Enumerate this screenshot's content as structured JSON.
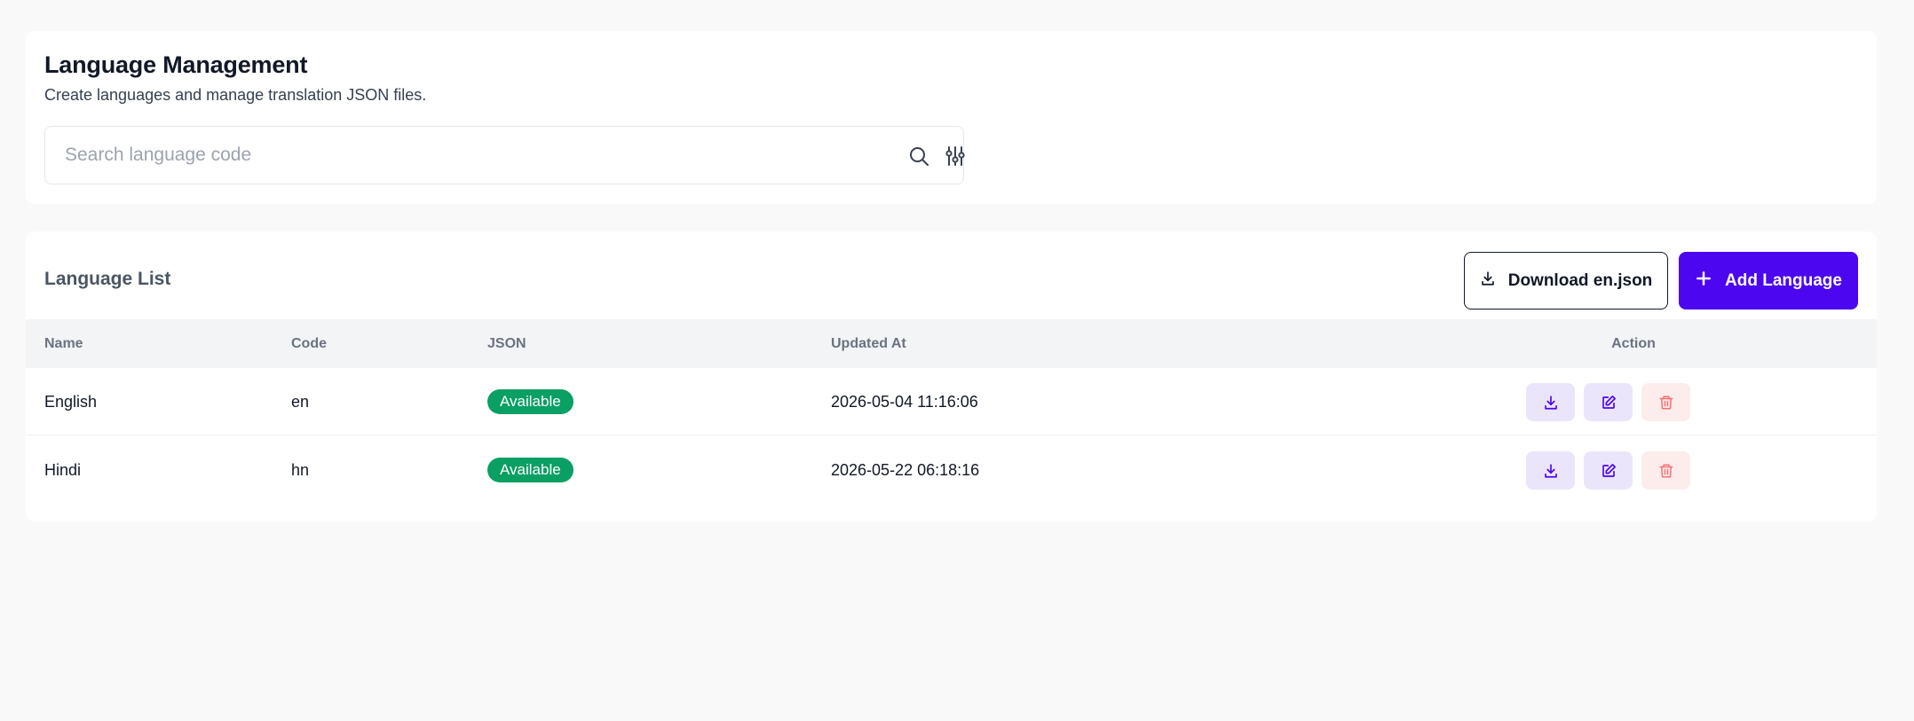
{
  "header": {
    "title": "Language Management",
    "subtitle": "Create languages and manage translation JSON files."
  },
  "search": {
    "placeholder": "Search language code",
    "value": "",
    "icons": [
      "search-icon",
      "sliders-icon"
    ]
  },
  "list": {
    "title": "Language List",
    "download_button_label": "Download en.json",
    "add_button_label": "Add Language",
    "columns": {
      "name": "Name",
      "code": "Code",
      "json": "JSON",
      "updated_at": "Updated At",
      "action": "Action"
    },
    "rows": [
      {
        "name": "English",
        "code": "en",
        "json_status": "Available",
        "updated_at": "2026-05-04 11:16:06"
      },
      {
        "name": "Hindi",
        "code": "hn",
        "json_status": "Available",
        "updated_at": "2026-05-22 06:18:16"
      }
    ],
    "row_actions": [
      "download-icon",
      "edit-icon",
      "trash-icon"
    ]
  },
  "colors": {
    "primary": "#4c06f0",
    "success_badge": "#0a9f63",
    "action_bg": "#ebe5fb",
    "action_icon": "#4c06f0",
    "danger_bg": "#fdecec",
    "danger_icon": "#f87171",
    "page_bg": "#f9f9f9"
  }
}
